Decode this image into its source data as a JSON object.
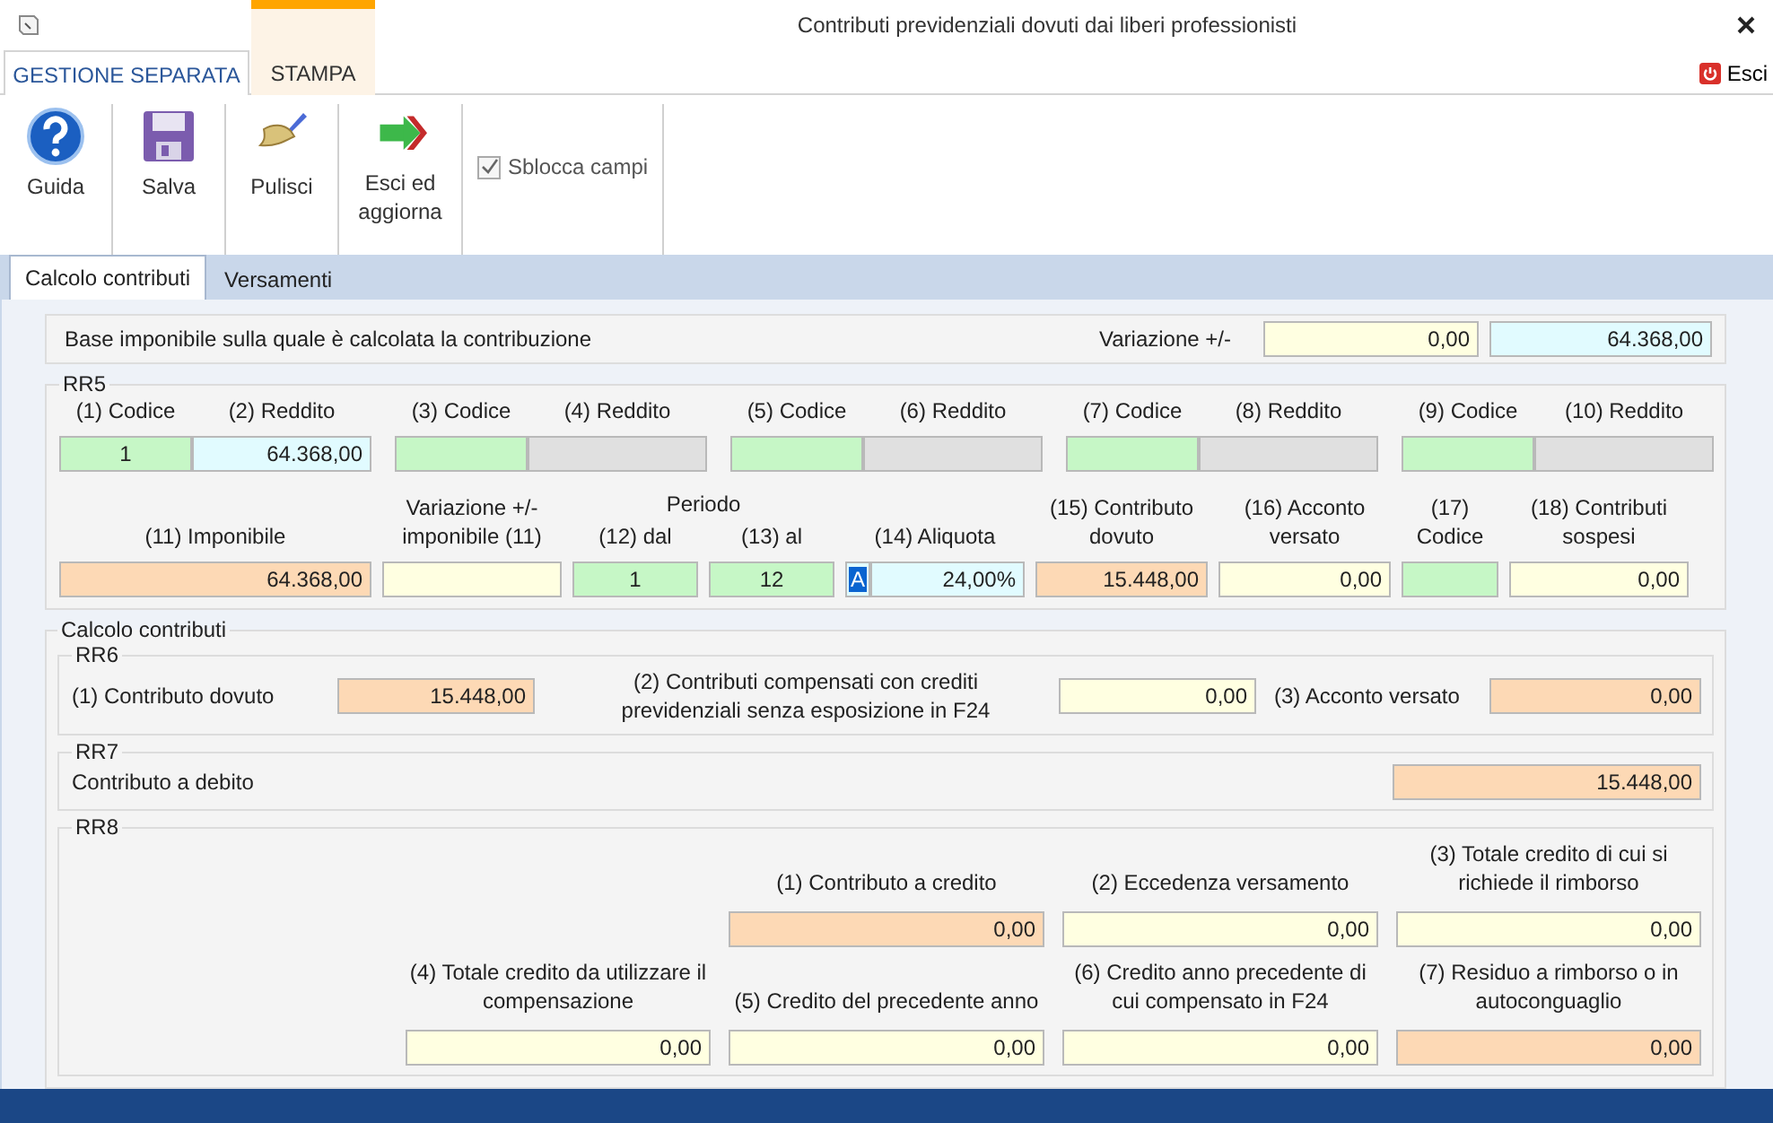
{
  "window": {
    "title": "Contributi previdenziali dovuti dai liberi professionisti"
  },
  "ribbon_tabs": [
    {
      "label": "GESTIONE SEPARATA",
      "selected": true,
      "contextual": false
    },
    {
      "label": "STAMPA",
      "selected": false,
      "contextual": true
    }
  ],
  "exit_button": {
    "label": "Esci"
  },
  "toolbar": [
    {
      "kind": "help",
      "label": "Guida"
    },
    {
      "kind": "save",
      "label": "Salva"
    },
    {
      "kind": "clear",
      "label": "Pulisci"
    },
    {
      "kind": "exit",
      "label": "Esci ed aggiorna"
    },
    {
      "kind": "checkbox",
      "label": "Sblocca campi",
      "checked": true
    }
  ],
  "form_tabs": [
    {
      "label": "Calcolo contributi",
      "selected": true
    },
    {
      "label": "Versamenti",
      "selected": false
    }
  ],
  "base": {
    "label": "Base imponibile sulla quale è calcolata la contribuzione",
    "variation_label": "Variazione +/-",
    "variation": {
      "value": "0,00",
      "kind": "input"
    },
    "total": {
      "value": "64.368,00",
      "kind": "income"
    }
  },
  "rr5": {
    "title": "RR5",
    "pairs": [
      {
        "code_label": "(1) Codice",
        "income_label": "(2) Reddito",
        "code": {
          "value": "1",
          "kind": "code"
        },
        "income": {
          "value": "64.368,00",
          "kind": "income"
        }
      },
      {
        "code_label": "(3) Codice",
        "income_label": "(4) Reddito",
        "code": {
          "kind": "code"
        },
        "income": {
          "kind": "disabled"
        }
      },
      {
        "code_label": "(5) Codice",
        "income_label": "(6) Reddito",
        "code": {
          "kind": "code"
        },
        "income": {
          "kind": "disabled"
        }
      },
      {
        "code_label": "(7) Codice",
        "income_label": "(8) Reddito",
        "code": {
          "kind": "code"
        },
        "income": {
          "kind": "disabled"
        }
      },
      {
        "code_label": "(9) Codice",
        "income_label": "(10) Reddito",
        "code": {
          "kind": "code"
        },
        "income": {
          "kind": "disabled"
        }
      }
    ],
    "columns": [
      {
        "kind": "single",
        "label": "(11) Imponibile",
        "fields": [
          {
            "value": "64.368,00",
            "kind": "computed"
          }
        ]
      },
      {
        "kind": "single",
        "label": "Variazione +/- imponibile (11)",
        "fields": [
          {
            "kind": "input"
          }
        ]
      },
      {
        "kind": "group",
        "label": "Periodo",
        "columns": [
          {
            "label": "(12) dal",
            "fields": [
              {
                "value": "1",
                "kind": "code"
              }
            ]
          },
          {
            "label": "(13) al",
            "fields": [
              {
                "value": "12",
                "kind": "code"
              }
            ]
          }
        ]
      },
      {
        "kind": "single",
        "label": "(14) Aliquota",
        "fields": [
          {
            "value": "A",
            "kind": "income",
            "highlighted": true
          },
          {
            "value": "24,00%",
            "kind": "income"
          }
        ]
      },
      {
        "kind": "single",
        "label": "(15) Contributo dovuto",
        "fields": [
          {
            "value": "15.448,00",
            "kind": "computed"
          }
        ]
      },
      {
        "kind": "single",
        "label": "(16) Acconto versato",
        "fields": [
          {
            "value": "0,00",
            "kind": "input"
          }
        ]
      },
      {
        "kind": "single",
        "label": "(17) Codice",
        "fields": [
          {
            "kind": "code"
          }
        ]
      },
      {
        "kind": "single",
        "label": "(18) Contributi sospesi",
        "fields": [
          {
            "value": "0,00",
            "kind": "input"
          }
        ]
      }
    ]
  },
  "calc": {
    "title": "Calcolo contributi",
    "rr6": {
      "title": "RR6",
      "items": [
        {
          "label": "(1) Contributo dovuto",
          "field": {
            "value": "15.448,00",
            "kind": "computed"
          }
        },
        {
          "label": "(2) Contributi compensati con crediti previdenziali senza esposizione in F24",
          "field": {
            "value": "0,00",
            "kind": "input"
          }
        },
        {
          "label": "(3) Acconto versato",
          "field": {
            "value": "0,00",
            "kind": "computed"
          }
        }
      ]
    },
    "rr7": {
      "title": "RR7",
      "label": "Contributo a debito",
      "field": {
        "value": "15.448,00",
        "kind": "computed"
      }
    },
    "rr8": {
      "title": "RR8",
      "rows": [
        [
          null,
          {
            "label": "(1) Contributo a credito",
            "field": {
              "value": "0,00",
              "kind": "computed"
            }
          },
          {
            "label": "(2) Eccedenza versamento",
            "field": {
              "value": "0,00",
              "kind": "input"
            }
          },
          {
            "label": "(3) Totale credito di cui si richiede il rimborso",
            "field": {
              "value": "0,00",
              "kind": "input"
            }
          }
        ],
        [
          {
            "label": "(4) Totale credito da utilizzare il compensazione",
            "field": {
              "value": "0,00",
              "kind": "input"
            }
          },
          {
            "label": "(5) Credito del precedente anno",
            "field": {
              "value": "0,00",
              "kind": "input"
            }
          },
          {
            "label": "(6) Credito anno precedente di cui compensato in F24",
            "field": {
              "value": "0,00",
              "kind": "input"
            }
          },
          {
            "label": "(7) Residuo a rimborso o in autoconguaglio",
            "field": {
              "value": "0,00",
              "kind": "computed"
            }
          }
        ]
      ]
    }
  }
}
